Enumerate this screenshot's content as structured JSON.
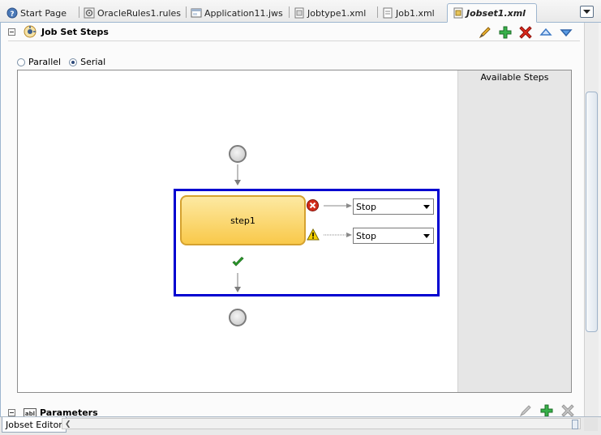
{
  "tabs": [
    {
      "label": "Start Page",
      "icon": "help-icon"
    },
    {
      "label": "OracleRules1.rules",
      "icon": "rules-file-icon"
    },
    {
      "label": "Application11.jws",
      "icon": "workspace-icon"
    },
    {
      "label": "Jobtype1.xml",
      "icon": "jobtype-file-icon"
    },
    {
      "label": "Job1.xml",
      "icon": "job-file-icon"
    },
    {
      "label": "Jobset1.xml",
      "icon": "jobset-file-icon",
      "active": true
    }
  ],
  "section": {
    "title": "Job Set Steps",
    "toolbar": [
      "edit-pencil-icon",
      "add-plus-icon",
      "delete-x-icon",
      "move-up-icon",
      "move-down-icon"
    ]
  },
  "mode": {
    "options": [
      "Parallel",
      "Serial"
    ],
    "selected": "Serial"
  },
  "canvas": {
    "available_steps_title": "Available Steps",
    "step_label": "step1",
    "error_action": "Stop",
    "warning_action": "Stop"
  },
  "parameters": {
    "title": "Parameters"
  },
  "editor_tab": "Jobset Editor",
  "colors": {
    "selection": "#0000d0",
    "step_fill": "#f9c94a",
    "error": "#d22b1a",
    "warning": "#f5d000",
    "success": "#2ea02e"
  }
}
